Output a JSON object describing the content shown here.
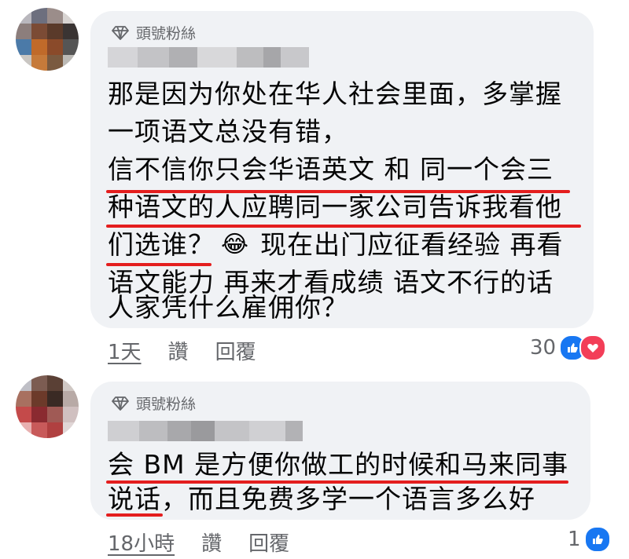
{
  "comments": [
    {
      "badge": "頭號粉絲",
      "lines": [
        "那是因为你处在华人社会里面，多掌握",
        "一项语文总没有错，",
        "信不信你只会华语英文 和 同一个会三",
        "种语文的人应聘同一家公司告诉我看他",
        "们选谁？",
        "现在出门应征看经验 再看",
        "语文能力 再来才看成绩 语文不行的话",
        "人家凭什么雇佣你？"
      ],
      "emoji": "😂",
      "time": "1天",
      "like_label": "讚",
      "reply_label": "回覆",
      "reaction_count": "30"
    },
    {
      "badge": "頭號粉絲",
      "lines": [
        "会 BM 是方便你做工的时候和马来同事",
        "说话，而且免费多学一个语言多么好"
      ],
      "time": "18小時",
      "like_label": "讚",
      "reply_label": "回覆",
      "reaction_count": "1"
    }
  ],
  "colors": {
    "underline": "#e41e1e",
    "like_blue": "#1877f2",
    "love_red": "#f33e58",
    "bubble": "#f0f2f5"
  }
}
